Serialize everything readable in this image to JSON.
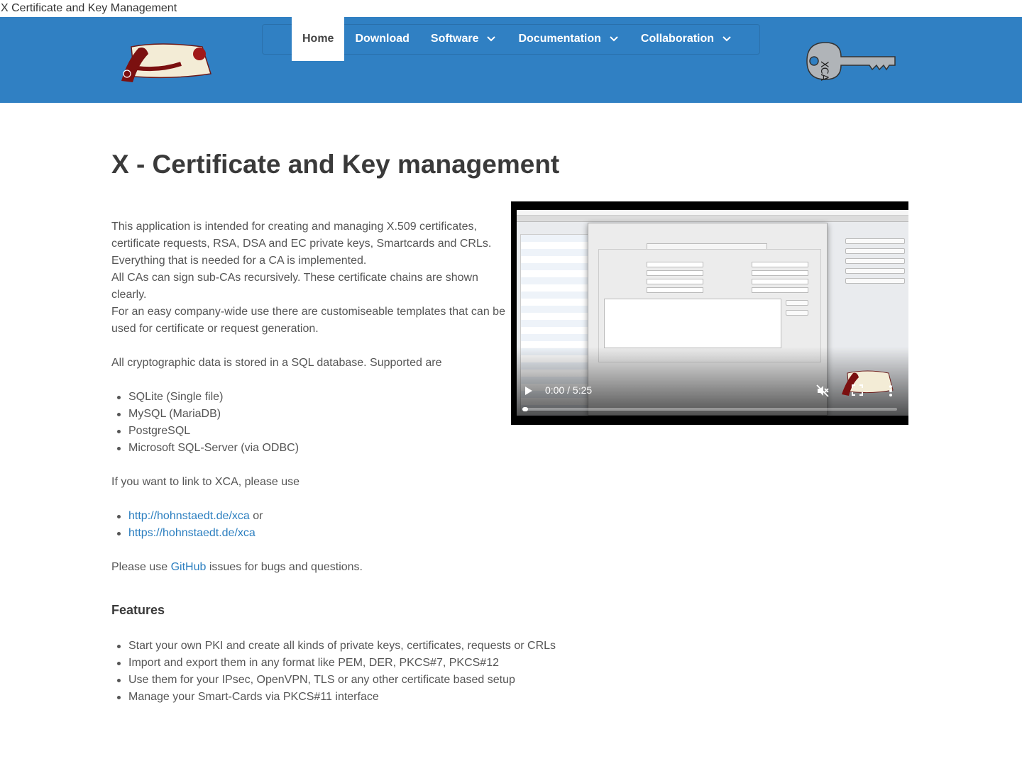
{
  "tab_title": "X Certificate and Key Management",
  "nav": {
    "items": [
      {
        "label": "Home",
        "active": true,
        "dropdown": false
      },
      {
        "label": "Download",
        "active": false,
        "dropdown": false
      },
      {
        "label": "Software",
        "active": false,
        "dropdown": true
      },
      {
        "label": "Documentation",
        "active": false,
        "dropdown": true
      },
      {
        "label": "Collaboration",
        "active": false,
        "dropdown": true
      }
    ]
  },
  "colors": {
    "header_bg": "#3080c3",
    "link": "#2c7fc0",
    "text": "#555555",
    "heading": "#3a3a3a"
  },
  "page": {
    "title": "X - Certificate and Key management",
    "intro_lines": [
      "This application is intended for creating and managing X.509 certificates, certificate requests, RSA, DSA and EC private keys, Smartcards and CRLs.",
      "Everything that is needed for a CA is implemented.",
      "All CAs can sign sub-CAs recursively. These certificate chains are shown clearly.",
      "For an easy company-wide use there are customiseable templates that can be used for certificate or request generation."
    ],
    "db_intro": "All cryptographic data is stored in a SQL database. Supported are",
    "databases": [
      "SQLite (Single file)",
      "MySQL (MariaDB)",
      "PostgreSQL",
      "Microsoft SQL-Server (via ODBC)"
    ],
    "link_intro": "If you want to link to XCA, please use",
    "links": [
      {
        "href": "http://hohnstaedt.de/xca",
        "text": "http://hohnstaedt.de/xca",
        "suffix": " or"
      },
      {
        "href": "https://hohnstaedt.de/xca",
        "text": "https://hohnstaedt.de/xca",
        "suffix": ""
      }
    ],
    "github_before": "Please use ",
    "github_link": "GitHub",
    "github_after": " issues for bugs and questions.",
    "features_title": "Features",
    "features": [
      "Start your own PKI and create all kinds of private keys, certificates, requests or CRLs",
      "Import and export them in any format like PEM, DER, PKCS#7, PKCS#12",
      "Use them for your IPsec, OpenVPN, TLS or any other certificate based setup",
      "Manage your Smart-Cards via PKCS#11 interface"
    ]
  },
  "video": {
    "time": "0:00 / 5:25",
    "progress": 0,
    "icons": [
      "play-icon",
      "muted-icon",
      "fullscreen-icon",
      "more-vert-icon"
    ]
  }
}
